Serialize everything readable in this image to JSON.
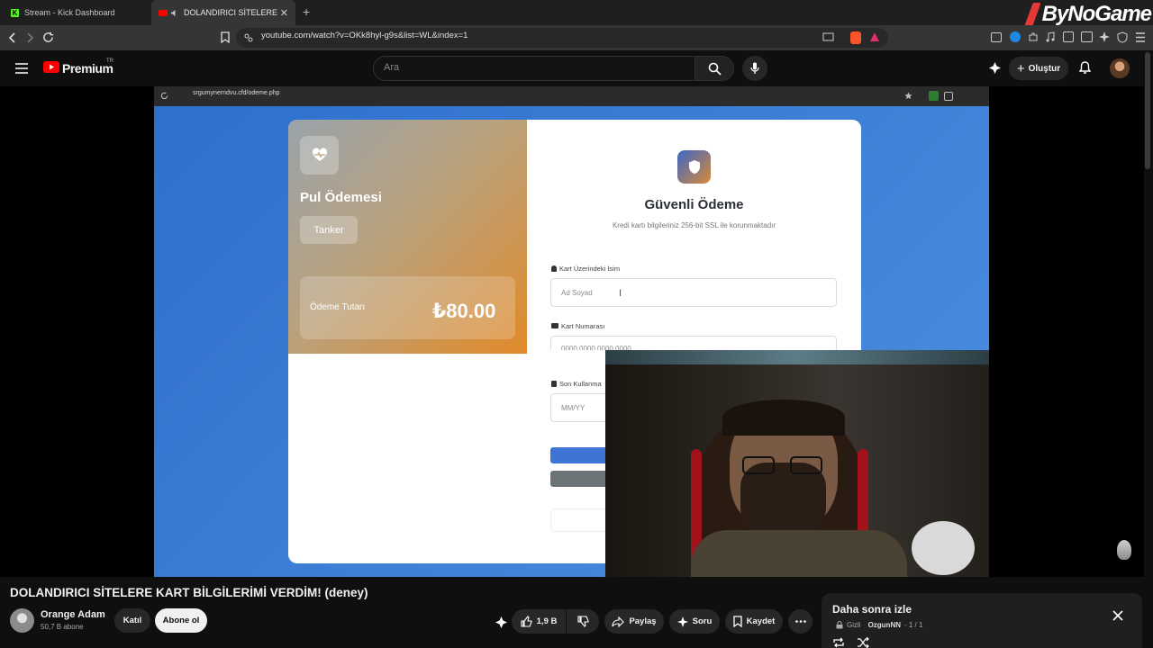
{
  "browser": {
    "tabs": [
      {
        "title": "Stream - Kick Dashboard",
        "active": false
      },
      {
        "title": "DOLANDIRICI SİTELERE KART",
        "active": true
      }
    ],
    "url": "youtube.com/watch?v=OKk8hyl-g9s&list=WL&index=1",
    "brand_logo": "ByNoGame"
  },
  "youtube": {
    "brand": "Premium",
    "region": "TR",
    "search_placeholder": "Ara",
    "create_label": "Oluştur"
  },
  "screen": {
    "inner_url": "srgumynerndvu.cfd/odeme.php",
    "card_left": {
      "title": "Pul Ödemesi",
      "tag": "Tanker",
      "amount_label": "Ödeme Tutarı",
      "amount_value": "₺80.00"
    },
    "form": {
      "title": "Güvenli Ödeme",
      "subtitle": "Kredi kartı bilgileriniz 256-bit SSL ile korunmaktadır",
      "name_label": "Kart Üzerindeki İsim",
      "name_placeholder": "Ad Soyad",
      "number_label": "Kart Numarası",
      "number_placeholder": "0000 0000 0000 0000",
      "expiry_label": "Son Kullanma",
      "expiry_placeholder": "MM/YY"
    }
  },
  "video": {
    "title": "DOLANDIRICI SİTELERE KART BİLGİLERİMİ VERDİM! (deney)",
    "channel": "Orange Adam",
    "subscribers": "50,7 B abone",
    "join_label": "Katıl",
    "subscribe_label": "Abone ol",
    "likes": "1,9 B",
    "share_label": "Paylaş",
    "ask_label": "Soru",
    "save_label": "Kaydet"
  },
  "watch_later": {
    "title": "Daha sonra izle",
    "privacy": "Gizli",
    "owner": "OzgunNN",
    "position": "- 1 / 1"
  },
  "colors": {
    "yt_red": "#ff0000",
    "form_blue": "#3e74d6",
    "card_orange": "#e08a2a"
  }
}
